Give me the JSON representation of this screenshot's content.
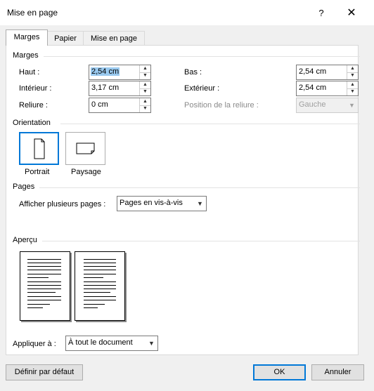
{
  "window": {
    "title": "Mise en page",
    "help": "?",
    "close": "✕"
  },
  "tabs": [
    {
      "label": "Marges"
    },
    {
      "label": "Papier"
    },
    {
      "label": "Mise en page"
    }
  ],
  "margins": {
    "section_label": "Marges",
    "haut": {
      "label": "Haut :",
      "value": "2,54 cm"
    },
    "bas": {
      "label": "Bas :",
      "value": "2,54 cm"
    },
    "interieur": {
      "label": "Intérieur :",
      "value": "3,17 cm"
    },
    "exterieur": {
      "label": "Extérieur :",
      "value": "2,54 cm"
    },
    "reliure": {
      "label": "Reliure :",
      "value": "0 cm"
    },
    "position_reliure": {
      "label": "Position de la reliure :",
      "value": "Gauche"
    }
  },
  "orientation": {
    "section_label": "Orientation",
    "portrait": {
      "label": "Portrait"
    },
    "paysage": {
      "label": "Paysage"
    }
  },
  "pages": {
    "section_label": "Pages",
    "afficher_label": "Afficher plusieurs pages :",
    "afficher_value": "Pages en vis-à-vis"
  },
  "apercu": {
    "section_label": "Aperçu"
  },
  "appliquer": {
    "label": "Appliquer à :",
    "value": "À tout le document"
  },
  "buttons": {
    "default": "Définir par défaut",
    "ok": "OK",
    "cancel": "Annuler"
  },
  "colors": {
    "accent": "#0078d7",
    "selection": "#99c9ef"
  },
  "icons": {
    "up": "spin-up-icon",
    "down": "spin-down-icon",
    "dropdown": "chevron-down-icon"
  }
}
